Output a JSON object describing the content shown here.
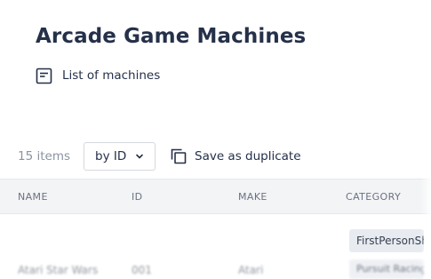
{
  "page": {
    "title": "Arcade Game Machines",
    "subtitle": "List of machines",
    "subtitle_icon": "list-view-icon"
  },
  "toolbar": {
    "item_count": "15 items",
    "sort_label": "by ID",
    "sort_icon": "chevron-down-icon",
    "duplicate_label": "Save as duplicate",
    "duplicate_icon": "copy-icon"
  },
  "table": {
    "columns": [
      "NAME",
      "ID",
      "MAKE",
      "CATEGORY"
    ],
    "first_row_category": "FirstPersonShooter",
    "partial_row": {
      "name": "Atari Star Wars",
      "id": "001",
      "make": "Atari",
      "category": "Pursuit Racing"
    }
  },
  "colors": {
    "text_primary": "#253049",
    "text_muted": "#8a93a3",
    "header_bg": "#f3f4f6",
    "chip_bg": "#e8ebf0"
  }
}
